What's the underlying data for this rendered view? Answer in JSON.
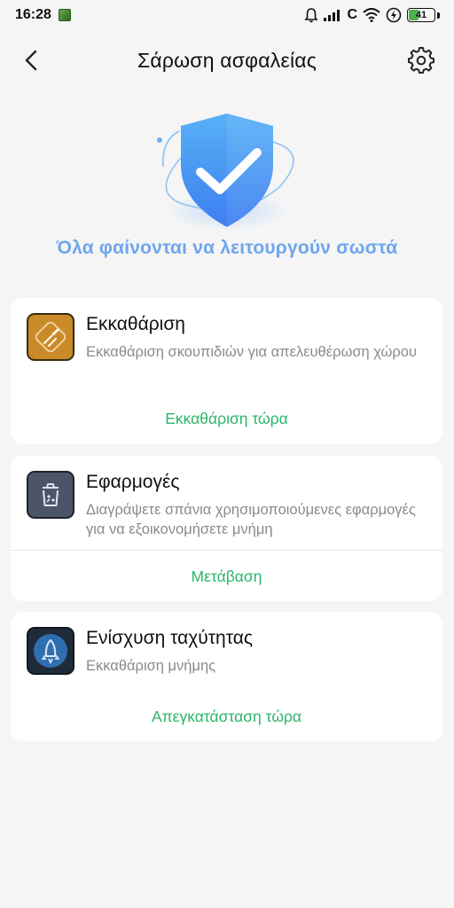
{
  "status_bar": {
    "time": "16:28",
    "carrier": "C",
    "battery_level": "41",
    "battery_fraction": 0.41
  },
  "header": {
    "title": "Σάρωση ασφαλείας",
    "back_icon": "chevron-left-icon",
    "settings_icon": "gear-icon"
  },
  "hero": {
    "icon": "shield-check-icon",
    "message": "Όλα φαίνονται να λειτουργούν σωστά",
    "accent_color": "#6ea6ee"
  },
  "cards": [
    {
      "title": "Εκκαθάριση",
      "description": "Εκκαθάριση σκουπιδιών για απελευθέρωση χώρου",
      "action": "Εκκαθάριση τώρα",
      "icon": "broom-icon",
      "icon_color": "#c98a2a"
    },
    {
      "title": "Εφαρμογές",
      "description": "Διαγράψετε σπάνια χρησιμοποιούμενες εφαρμογές για να εξοικονομήσετε μνήμη",
      "action": "Μετάβαση",
      "icon": "trash-bin-icon",
      "icon_color": "#4b5567"
    },
    {
      "title": "Ενίσχυση ταχύτητας",
      "description": "Εκκαθάριση μνήμης",
      "action": "Απεγκατάσταση τώρα",
      "icon": "rocket-icon",
      "icon_color": "#2f6fb0"
    }
  ],
  "action_color": "#2bb56a"
}
